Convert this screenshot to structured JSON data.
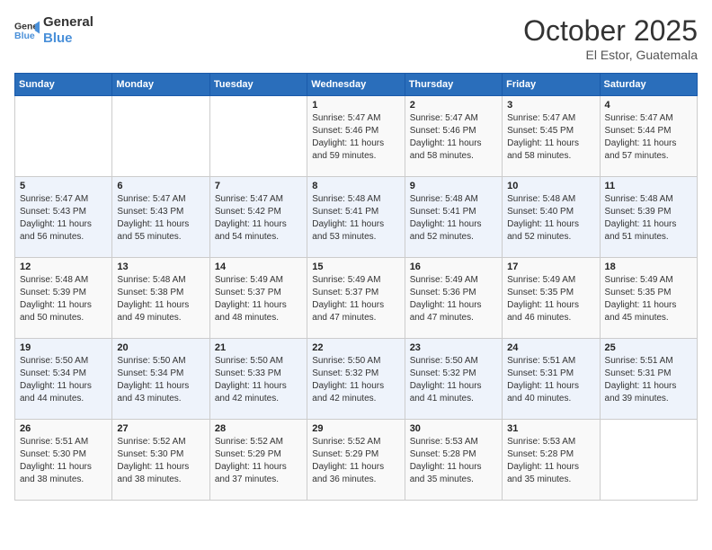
{
  "header": {
    "logo_line1": "General",
    "logo_line2": "Blue",
    "month": "October 2025",
    "location": "El Estor, Guatemala"
  },
  "weekdays": [
    "Sunday",
    "Monday",
    "Tuesday",
    "Wednesday",
    "Thursday",
    "Friday",
    "Saturday"
  ],
  "weeks": [
    [
      {
        "day": "",
        "info": ""
      },
      {
        "day": "",
        "info": ""
      },
      {
        "day": "",
        "info": ""
      },
      {
        "day": "1",
        "info": "Sunrise: 5:47 AM\nSunset: 5:46 PM\nDaylight: 11 hours and 59 minutes."
      },
      {
        "day": "2",
        "info": "Sunrise: 5:47 AM\nSunset: 5:46 PM\nDaylight: 11 hours and 58 minutes."
      },
      {
        "day": "3",
        "info": "Sunrise: 5:47 AM\nSunset: 5:45 PM\nDaylight: 11 hours and 58 minutes."
      },
      {
        "day": "4",
        "info": "Sunrise: 5:47 AM\nSunset: 5:44 PM\nDaylight: 11 hours and 57 minutes."
      }
    ],
    [
      {
        "day": "5",
        "info": "Sunrise: 5:47 AM\nSunset: 5:43 PM\nDaylight: 11 hours and 56 minutes."
      },
      {
        "day": "6",
        "info": "Sunrise: 5:47 AM\nSunset: 5:43 PM\nDaylight: 11 hours and 55 minutes."
      },
      {
        "day": "7",
        "info": "Sunrise: 5:47 AM\nSunset: 5:42 PM\nDaylight: 11 hours and 54 minutes."
      },
      {
        "day": "8",
        "info": "Sunrise: 5:48 AM\nSunset: 5:41 PM\nDaylight: 11 hours and 53 minutes."
      },
      {
        "day": "9",
        "info": "Sunrise: 5:48 AM\nSunset: 5:41 PM\nDaylight: 11 hours and 52 minutes."
      },
      {
        "day": "10",
        "info": "Sunrise: 5:48 AM\nSunset: 5:40 PM\nDaylight: 11 hours and 52 minutes."
      },
      {
        "day": "11",
        "info": "Sunrise: 5:48 AM\nSunset: 5:39 PM\nDaylight: 11 hours and 51 minutes."
      }
    ],
    [
      {
        "day": "12",
        "info": "Sunrise: 5:48 AM\nSunset: 5:39 PM\nDaylight: 11 hours and 50 minutes."
      },
      {
        "day": "13",
        "info": "Sunrise: 5:48 AM\nSunset: 5:38 PM\nDaylight: 11 hours and 49 minutes."
      },
      {
        "day": "14",
        "info": "Sunrise: 5:49 AM\nSunset: 5:37 PM\nDaylight: 11 hours and 48 minutes."
      },
      {
        "day": "15",
        "info": "Sunrise: 5:49 AM\nSunset: 5:37 PM\nDaylight: 11 hours and 47 minutes."
      },
      {
        "day": "16",
        "info": "Sunrise: 5:49 AM\nSunset: 5:36 PM\nDaylight: 11 hours and 47 minutes."
      },
      {
        "day": "17",
        "info": "Sunrise: 5:49 AM\nSunset: 5:35 PM\nDaylight: 11 hours and 46 minutes."
      },
      {
        "day": "18",
        "info": "Sunrise: 5:49 AM\nSunset: 5:35 PM\nDaylight: 11 hours and 45 minutes."
      }
    ],
    [
      {
        "day": "19",
        "info": "Sunrise: 5:50 AM\nSunset: 5:34 PM\nDaylight: 11 hours and 44 minutes."
      },
      {
        "day": "20",
        "info": "Sunrise: 5:50 AM\nSunset: 5:34 PM\nDaylight: 11 hours and 43 minutes."
      },
      {
        "day": "21",
        "info": "Sunrise: 5:50 AM\nSunset: 5:33 PM\nDaylight: 11 hours and 42 minutes."
      },
      {
        "day": "22",
        "info": "Sunrise: 5:50 AM\nSunset: 5:32 PM\nDaylight: 11 hours and 42 minutes."
      },
      {
        "day": "23",
        "info": "Sunrise: 5:50 AM\nSunset: 5:32 PM\nDaylight: 11 hours and 41 minutes."
      },
      {
        "day": "24",
        "info": "Sunrise: 5:51 AM\nSunset: 5:31 PM\nDaylight: 11 hours and 40 minutes."
      },
      {
        "day": "25",
        "info": "Sunrise: 5:51 AM\nSunset: 5:31 PM\nDaylight: 11 hours and 39 minutes."
      }
    ],
    [
      {
        "day": "26",
        "info": "Sunrise: 5:51 AM\nSunset: 5:30 PM\nDaylight: 11 hours and 38 minutes."
      },
      {
        "day": "27",
        "info": "Sunrise: 5:52 AM\nSunset: 5:30 PM\nDaylight: 11 hours and 38 minutes."
      },
      {
        "day": "28",
        "info": "Sunrise: 5:52 AM\nSunset: 5:29 PM\nDaylight: 11 hours and 37 minutes."
      },
      {
        "day": "29",
        "info": "Sunrise: 5:52 AM\nSunset: 5:29 PM\nDaylight: 11 hours and 36 minutes."
      },
      {
        "day": "30",
        "info": "Sunrise: 5:53 AM\nSunset: 5:28 PM\nDaylight: 11 hours and 35 minutes."
      },
      {
        "day": "31",
        "info": "Sunrise: 5:53 AM\nSunset: 5:28 PM\nDaylight: 11 hours and 35 minutes."
      },
      {
        "day": "",
        "info": ""
      }
    ]
  ]
}
